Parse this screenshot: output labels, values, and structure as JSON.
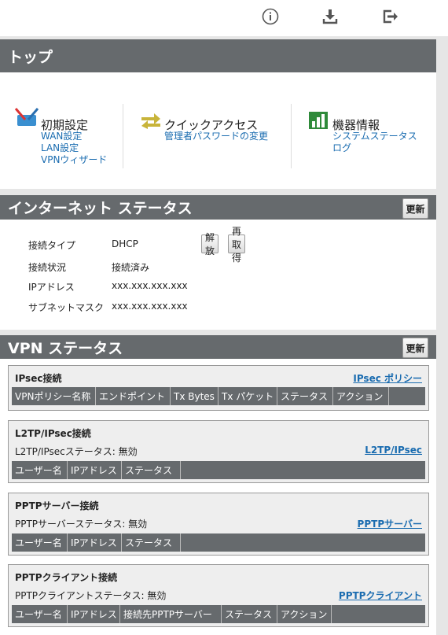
{
  "top_icons": [
    "info-icon",
    "download-icon",
    "logout-icon"
  ],
  "top": {
    "title": "トップ",
    "groups": [
      {
        "heading": "初期設定",
        "links": [
          "WAN設定",
          "LAN設定",
          "VPNウィザード"
        ]
      },
      {
        "heading": "クイックアクセス",
        "links": [
          "管理者パスワードの変更"
        ]
      },
      {
        "heading": "機器情報",
        "links": [
          "システムステータス",
          "ログ"
        ]
      }
    ]
  },
  "internet": {
    "title": "インターネット ステータス",
    "refresh": "更新",
    "rows": [
      {
        "label": "接続タイプ",
        "value": "DHCP"
      },
      {
        "label": "接続状況",
        "value": "接続済み"
      },
      {
        "label": "IPアドレス",
        "value": "xxx.xxx.xxx.xxx"
      },
      {
        "label": "サブネットマスク",
        "value": "xxx.xxx.xxx.xxx"
      }
    ],
    "release": "解放",
    "renew": "再取得"
  },
  "vpn": {
    "title": "VPN ステータス",
    "refresh": "更新",
    "ipsec": {
      "title": "IPsec接続",
      "link": "IPsec ポリシー",
      "columns": [
        "VPNポリシー名称",
        "エンドポイント",
        "Tx Bytes",
        "Tx パケット",
        "ステータス",
        "アクション"
      ]
    },
    "l2tp": {
      "title": "L2TP/IPsec接続",
      "status": "L2TP/IPsecステータス: 無効",
      "link": "L2TP/IPsec",
      "columns": [
        "ユーザー名",
        "IPアドレス",
        "ステータス"
      ]
    },
    "pptps": {
      "title": "PPTPサーバー接続",
      "status": "PPTPサーバーステータス: 無効",
      "link": "PPTPサーバー",
      "columns": [
        "ユーザー名",
        "IPアドレス",
        "ステータス"
      ]
    },
    "pptpc": {
      "title": "PPTPクライアント接続",
      "status": "PPTPクライアントステータス: 無効",
      "link": "PPTPクライアント",
      "columns": [
        "ユーザー名",
        "IPアドレス",
        "接続先PPTPサーバー",
        "ステータス",
        "アクション"
      ]
    }
  }
}
